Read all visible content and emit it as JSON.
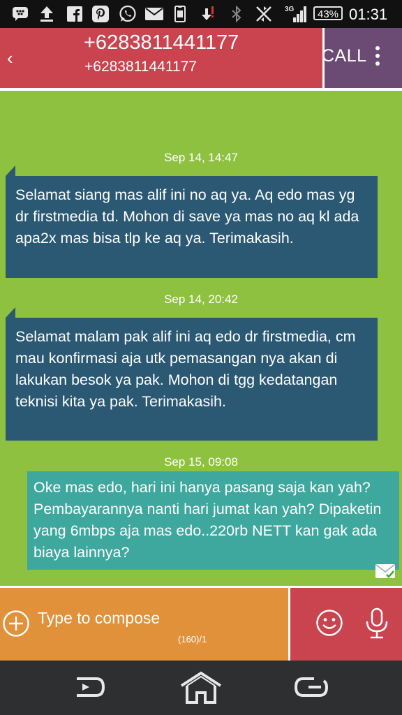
{
  "status_bar": {
    "icons": [
      "bbm-icon",
      "upload-icon",
      "facebook-icon",
      "pinterest-icon",
      "whatsapp-icon",
      "mail-icon",
      "sim-icon",
      "download-icon",
      "bluetooth-icon",
      "nfc-icon",
      "signal-icon"
    ],
    "network": "3G",
    "battery": "43%",
    "time": "01:31"
  },
  "header": {
    "back": "‹",
    "title": "+6283811441177",
    "subtitle": "+6283811441177",
    "call_label": "CALL"
  },
  "messages": [
    {
      "date": "Sep 14, 14:47",
      "direction": "incoming",
      "text": "Selamat siang mas alif ini no aq ya. Aq edo mas yg dr firstmedia td. Mohon di save ya mas no aq kl ada apa2x mas bisa tlp ke aq ya. Terimakasih."
    },
    {
      "date": "Sep 14, 20:42",
      "direction": "incoming",
      "text": "Selamat malam pak alif ini aq edo dr firstmedia, cm mau konfirmasi aja utk pemasangan nya akan di lakukan besok ya pak. Mohon di tgg kedatangan teknisi kita ya pak. Terimakasih."
    },
    {
      "date": "Sep 15, 09:08",
      "direction": "outgoing",
      "text": "Oke mas edo, hari ini hanya pasang saja kan yah? Pembayarannya nanti hari jumat kan yah? Dipaketin yang 6mbps aja mas edo..220rb NETT kan gak ada biaya lainnya?"
    }
  ],
  "compose": {
    "placeholder": "Type to compose",
    "counter": "(160)/1"
  },
  "colors": {
    "header_bg": "#c9444f",
    "menu_bg": "#6b4b73",
    "thread_bg": "#8fc141",
    "incoming_bubble": "#2b5873",
    "outgoing_bubble": "#3fa89e",
    "compose_bg": "#e0913a",
    "navbar_bg": "#2d2f31"
  }
}
